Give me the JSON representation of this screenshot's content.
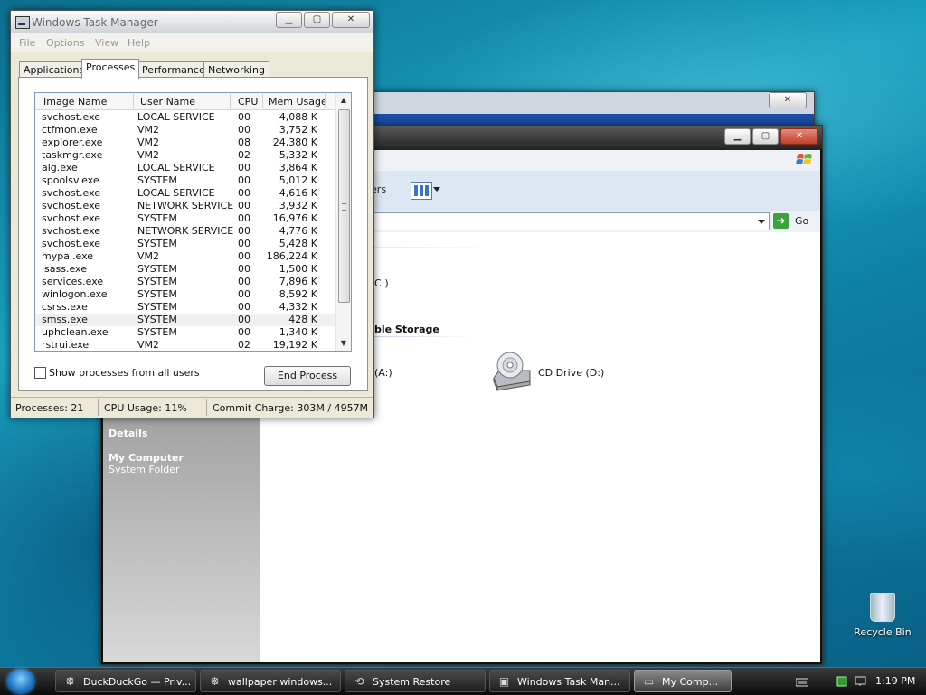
{
  "taskmgr": {
    "title": "Windows Task Manager",
    "menu": [
      "File",
      "Options",
      "View",
      "Help"
    ],
    "tabs": [
      "Applications",
      "Processes",
      "Performance",
      "Networking"
    ],
    "columns": [
      "Image Name",
      "User Name",
      "CPU",
      "Mem Usage"
    ],
    "processes": [
      {
        "name": "svchost.exe",
        "user": "LOCAL SERVICE",
        "cpu": "00",
        "mem": "4,088 K"
      },
      {
        "name": "ctfmon.exe",
        "user": "VM2",
        "cpu": "00",
        "mem": "3,752 K"
      },
      {
        "name": "explorer.exe",
        "user": "VM2",
        "cpu": "08",
        "mem": "24,380 K"
      },
      {
        "name": "taskmgr.exe",
        "user": "VM2",
        "cpu": "02",
        "mem": "5,332 K"
      },
      {
        "name": "alg.exe",
        "user": "LOCAL SERVICE",
        "cpu": "00",
        "mem": "3,864 K"
      },
      {
        "name": "spoolsv.exe",
        "user": "SYSTEM",
        "cpu": "00",
        "mem": "5,012 K"
      },
      {
        "name": "svchost.exe",
        "user": "LOCAL SERVICE",
        "cpu": "00",
        "mem": "4,616 K"
      },
      {
        "name": "svchost.exe",
        "user": "NETWORK SERVICE",
        "cpu": "00",
        "mem": "3,932 K"
      },
      {
        "name": "svchost.exe",
        "user": "SYSTEM",
        "cpu": "00",
        "mem": "16,976 K"
      },
      {
        "name": "svchost.exe",
        "user": "NETWORK SERVICE",
        "cpu": "00",
        "mem": "4,776 K"
      },
      {
        "name": "svchost.exe",
        "user": "SYSTEM",
        "cpu": "00",
        "mem": "5,428 K"
      },
      {
        "name": "mypal.exe",
        "user": "VM2",
        "cpu": "00",
        "mem": "186,224 K"
      },
      {
        "name": "lsass.exe",
        "user": "SYSTEM",
        "cpu": "00",
        "mem": "1,500 K"
      },
      {
        "name": "services.exe",
        "user": "SYSTEM",
        "cpu": "00",
        "mem": "7,896 K"
      },
      {
        "name": "winlogon.exe",
        "user": "SYSTEM",
        "cpu": "00",
        "mem": "8,592 K"
      },
      {
        "name": "csrss.exe",
        "user": "SYSTEM",
        "cpu": "00",
        "mem": "4,332 K"
      },
      {
        "name": "smss.exe",
        "user": "SYSTEM",
        "cpu": "00",
        "mem": "428 K"
      },
      {
        "name": "uphclean.exe",
        "user": "SYSTEM",
        "cpu": "00",
        "mem": "1,340 K"
      },
      {
        "name": "rstrui.exe",
        "user": "VM2",
        "cpu": "02",
        "mem": "19,192 K"
      }
    ],
    "show_all_label": "Show processes from all users",
    "end_process_label": "End Process",
    "status": {
      "processes": "Processes: 21",
      "cpu": "CPU Usage: 11%",
      "commit": "Commit Charge: 303M / 4957M"
    }
  },
  "mycomputer": {
    "toolbar_partial": "lders",
    "go_label": "Go",
    "drive_c_partial": "C:)",
    "group_removable_partial": "ble Storage",
    "floppy_partial": "(A:)",
    "cd_drive_label": "CD Drive (D:)",
    "details_heading": "Details",
    "details_title": "My Computer",
    "details_subtitle": "System Folder"
  },
  "desktop": {
    "recycle_bin_label": "Recycle Bin"
  },
  "taskbar": {
    "buttons": [
      {
        "label": "DuckDuckGo — Priv...",
        "icon": "raccoon-icon"
      },
      {
        "label": "wallpaper windows...",
        "icon": "raccoon-icon"
      },
      {
        "label": "System Restore",
        "icon": "system-restore-icon"
      },
      {
        "label": "Windows Task Man...",
        "icon": "task-manager-icon"
      },
      {
        "label": "My Comp...",
        "icon": "my-computer-icon"
      }
    ],
    "clock": "1:19 PM"
  }
}
